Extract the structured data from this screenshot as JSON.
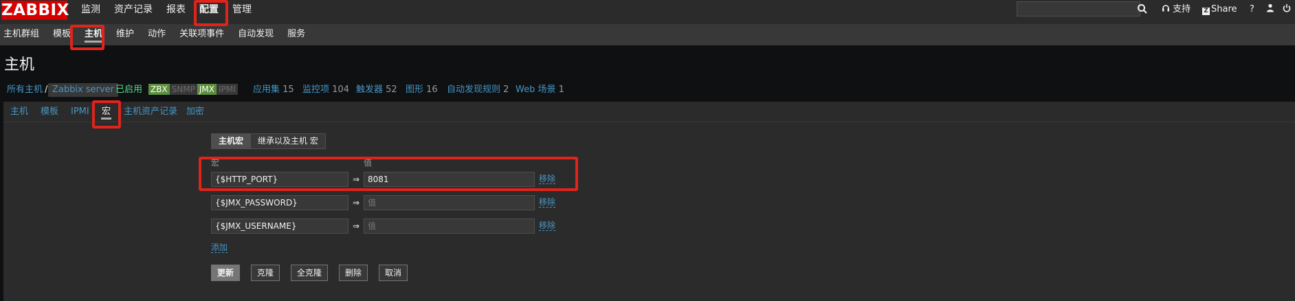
{
  "header": {
    "logo": "ZABBIX",
    "menu": [
      "监测",
      "资产记录",
      "报表",
      "配置",
      "管理"
    ],
    "active_menu_index": 3,
    "search_placeholder": "",
    "support": "支持",
    "share_icon_letter": "Z",
    "share": "Share",
    "help": "?",
    "user_icon": "user-icon",
    "logout_icon": "power-icon"
  },
  "submenu": {
    "items": [
      "主机群组",
      "模板",
      "主机",
      "维护",
      "动作",
      "关联项事件",
      "自动发现",
      "服务"
    ],
    "active_index": 2
  },
  "page_title": "主机",
  "breadcrumb": {
    "all_hosts": "所有主机",
    "sep": "/",
    "host": "Zabbix server",
    "status": "已启用",
    "badges": [
      {
        "label": "ZBX",
        "on": true
      },
      {
        "label": "SNMP",
        "on": false
      },
      {
        "label": "JMX",
        "on": true
      },
      {
        "label": "IPMI",
        "on": false
      }
    ],
    "applications": {
      "label": "应用集",
      "count": "15"
    },
    "items": {
      "label": "监控项",
      "count": "104"
    },
    "triggers": {
      "label": "触发器",
      "count": "52"
    },
    "graphs": {
      "label": "图形",
      "count": "16"
    },
    "discovery": {
      "label": "自动发现规则",
      "count": "2"
    },
    "web": {
      "label": "Web 场景",
      "count": "1"
    }
  },
  "tabs": {
    "items": [
      "主机",
      "模板",
      "IPMI",
      "宏",
      "主机资产记录",
      "加密"
    ],
    "active_index": 3
  },
  "macros": {
    "toggle": [
      "主机宏",
      "继承以及主机 宏"
    ],
    "toggle_active_index": 0,
    "col_macro": "宏",
    "col_value": "值",
    "arrow": "⇒",
    "value_placeholder": "值",
    "remove_label": "移除",
    "rows": [
      {
        "macro": "{$HTTP_PORT}",
        "value": "8081"
      },
      {
        "macro": "{$JMX_PASSWORD}",
        "value": ""
      },
      {
        "macro": "{$JMX_USERNAME}",
        "value": ""
      }
    ],
    "add_label": "添加"
  },
  "buttons": {
    "update": "更新",
    "clone": "克隆",
    "full_clone": "全克隆",
    "delete": "删除",
    "cancel": "取消"
  },
  "colors": {
    "accent_link": "#4796c4",
    "annotation": "#e0231b",
    "enabled": "#59db8f",
    "logo_bg": "#d40000"
  }
}
